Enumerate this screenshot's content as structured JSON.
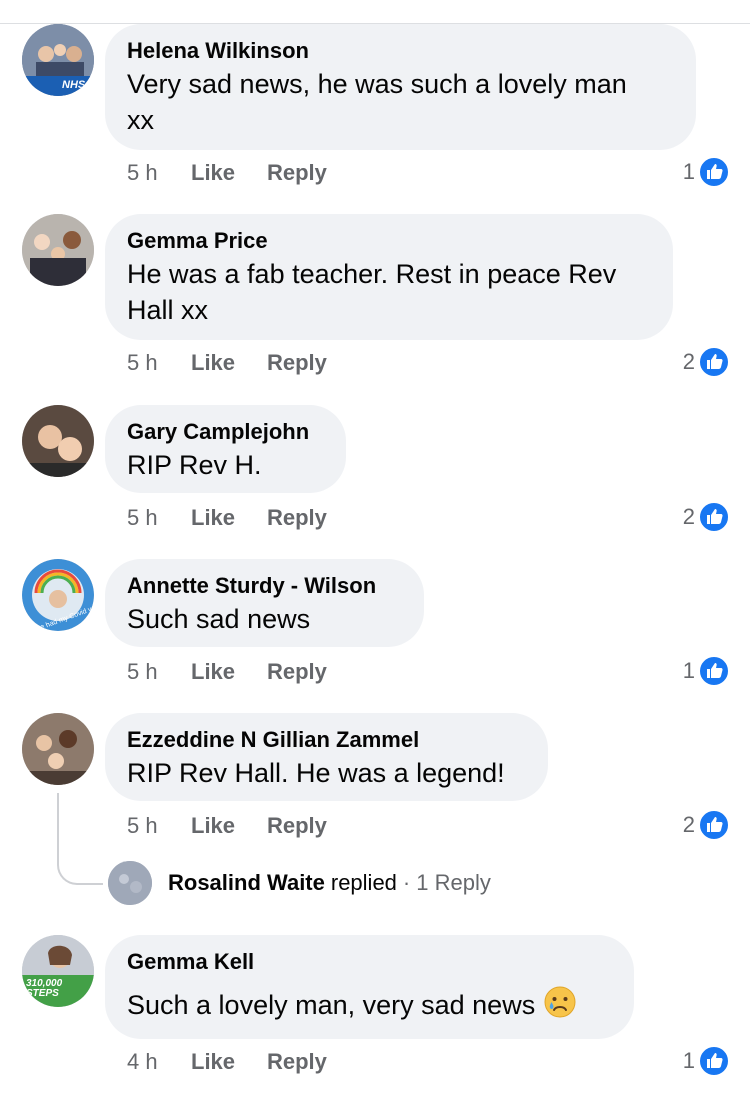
{
  "comments": [
    {
      "name": "Helena Wilkinson",
      "text_line1": "Very sad news,  he was such a lovely man",
      "text_line2": "xx",
      "time": "5 h",
      "like_label": "Like",
      "reply_label": "Reply",
      "reaction_count": "1",
      "avatar_badge": "NHS"
    },
    {
      "name": "Gemma Price",
      "text_line1": "He was a fab teacher. Rest in peace Rev",
      "text_line2": "Hall xx",
      "time": "5 h",
      "like_label": "Like",
      "reply_label": "Reply",
      "reaction_count": "2"
    },
    {
      "name": "Gary Camplejohn",
      "text_line1": "RIP Rev H.",
      "time": "5 h",
      "like_label": "Like",
      "reply_label": "Reply",
      "reaction_count": "2"
    },
    {
      "name": "Annette Sturdy - Wilson",
      "text_line1": "Such sad news",
      "time": "5 h",
      "like_label": "Like",
      "reply_label": "Reply",
      "reaction_count": "1",
      "avatar_badge": "I've had my Covid vaccine"
    },
    {
      "name": "Ezzeddine N Gillian Zammel",
      "text_line1": "RIP Rev Hall. He was a legend!",
      "time": "5 h",
      "like_label": "Like",
      "reply_label": "Reply",
      "reaction_count": "2"
    },
    {
      "name": "Gemma Kell",
      "text_line1": "Such a lovely man, very sad news",
      "time": "4 h",
      "like_label": "Like",
      "reply_label": "Reply",
      "reaction_count": "1",
      "avatar_badge_line1": "310,000",
      "avatar_badge_line2": "STEPS"
    }
  ],
  "reply_preview": {
    "name": "Rosalind Waite",
    "replied_word": "replied",
    "separator": "·",
    "count_label": "1 Reply"
  },
  "icons": {
    "like_reaction": "thumbs-up-icon",
    "emoji": "crying-face-emoji"
  },
  "colors": {
    "bubble": "#f0f2f5",
    "meta_text": "#65676b",
    "like_blue": "#1877f2"
  }
}
